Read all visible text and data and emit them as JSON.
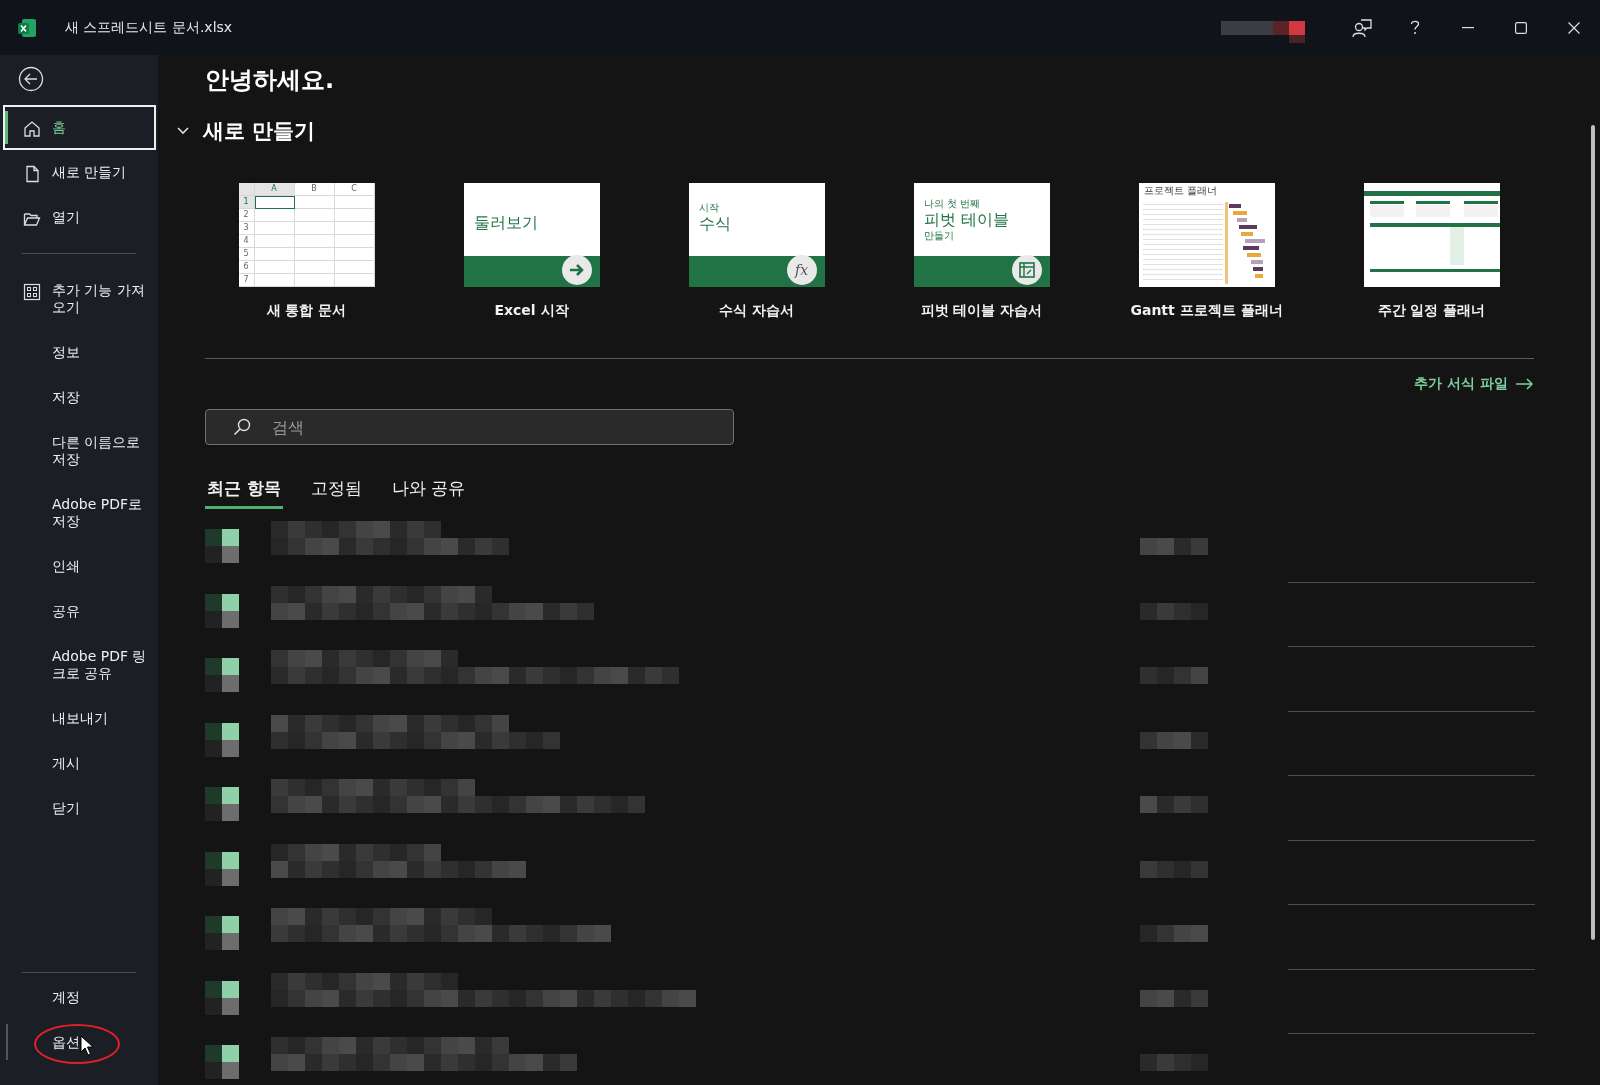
{
  "window": {
    "title": "새 스프레드시트 문서.xlsx"
  },
  "sidebar": {
    "primary": [
      {
        "label": "홈",
        "selected": true
      },
      {
        "label": "새로 만들기",
        "selected": false
      },
      {
        "label": "열기",
        "selected": false
      }
    ],
    "secondary": [
      {
        "label": "추가 기능 가져오기",
        "selected": false
      },
      {
        "label": "정보",
        "selected": false
      },
      {
        "label": "저장",
        "selected": false
      },
      {
        "label": "다른 이름으로 저장",
        "selected": false
      },
      {
        "label": "Adobe PDF로 저장",
        "selected": false
      },
      {
        "label": "인쇄",
        "selected": false
      },
      {
        "label": "공유",
        "selected": false
      },
      {
        "label": "Adobe PDF 링크로 공유",
        "selected": false
      },
      {
        "label": "내보내기",
        "selected": false
      },
      {
        "label": "게시",
        "selected": false
      },
      {
        "label": "닫기",
        "selected": false
      }
    ],
    "footer": [
      {
        "label": "계정",
        "selected": false,
        "highlighted": false
      },
      {
        "label": "옵션",
        "selected": false,
        "highlighted": true
      }
    ]
  },
  "greeting": "안녕하세요.",
  "new_section": {
    "title": "새로 만들기",
    "expanded": true,
    "templates": [
      {
        "kind": "grid",
        "label": "새 통합 문서",
        "columns": [
          "A",
          "B",
          "C"
        ],
        "rows": [
          "1",
          "2",
          "3",
          "4",
          "5",
          "6",
          "7"
        ]
      },
      {
        "kind": "tour",
        "label": "Excel 시작",
        "lines": [
          "둘러보기"
        ]
      },
      {
        "kind": "formula",
        "label": "수식 자습서",
        "lines": [
          "시작",
          "수식"
        ],
        "badge": "fx"
      },
      {
        "kind": "pivot",
        "label": "피벗 테이블 자습서",
        "lines": [
          "나의 첫 번째",
          "피벗 테이블",
          "만들기"
        ]
      },
      {
        "kind": "gantt",
        "label": "Gantt 프로젝트 플래너",
        "title": "프로젝트 플래너"
      },
      {
        "kind": "weekly",
        "label": "주간 일정 플래너"
      }
    ],
    "more_link": "추가 서식 파일"
  },
  "search": {
    "placeholder": "검색"
  },
  "tabs": [
    {
      "label": "최근 항목",
      "selected": true
    },
    {
      "label": "고정됨",
      "selected": false
    },
    {
      "label": "나와 공유",
      "selected": false
    }
  ],
  "recent_items": [
    {
      "kind": "redacted"
    },
    {
      "kind": "redacted"
    },
    {
      "kind": "redacted"
    },
    {
      "kind": "redacted"
    },
    {
      "kind": "redacted"
    },
    {
      "kind": "redacted"
    },
    {
      "kind": "redacted"
    },
    {
      "kind": "redacted"
    },
    {
      "kind": "redacted"
    }
  ]
}
